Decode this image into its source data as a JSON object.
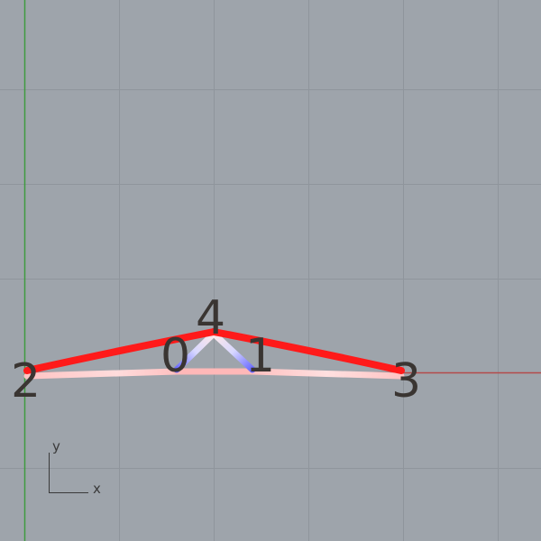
{
  "viewport": {
    "background": "#9ea4ab",
    "grid_color": "#8f959c",
    "x_axis_color": "#b34a4a",
    "y_axis_color": "#3f9a3f"
  },
  "node_labels": {
    "n0": "0",
    "n1": "1",
    "n2": "2",
    "n3": "3",
    "n4": "4"
  },
  "axis_gizmo": {
    "x_label": "x",
    "y_label": "y"
  },
  "edge_colors": {
    "high": "#ff1a1a",
    "low": "#ffb3b3",
    "compression": "#5555ff"
  }
}
